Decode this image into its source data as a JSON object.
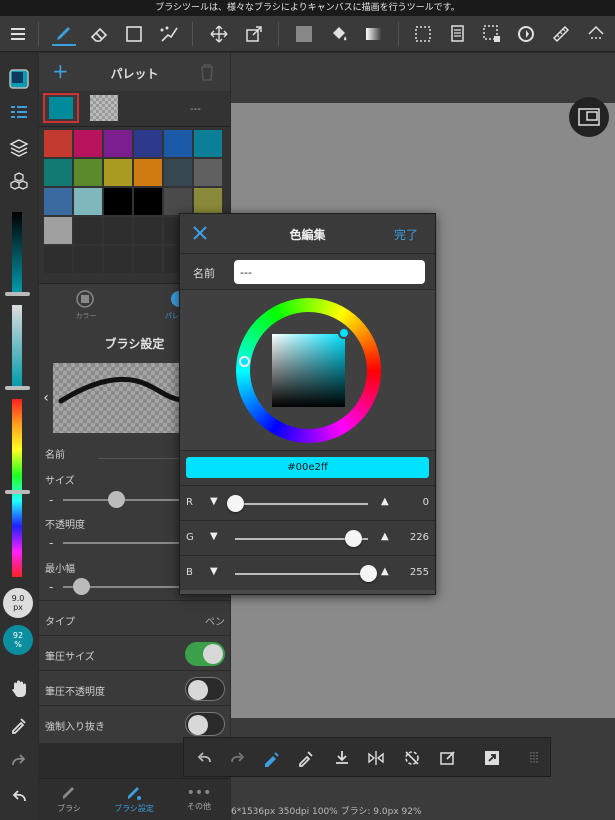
{
  "tipbar": {
    "text": "ブラシツールは、様々なブラシによりキャンバスに描画を行うツールです。"
  },
  "toolbar": {
    "icons": [
      "menu-icon",
      "brush-icon",
      "eraser-icon",
      "rect-icon",
      "dot-brush-icon",
      "move-icon",
      "transform-icon",
      "fill-color-icon",
      "bucket-icon",
      "gradient-icon",
      "select-icon",
      "layer-list-icon",
      "select-rect-icon",
      "rotate-icon",
      "ruler-icon",
      "snap-icon"
    ]
  },
  "palette": {
    "title": "パレット",
    "add_label": "+",
    "current_name": "---",
    "current_color": "#008b9a",
    "colors": [
      [
        "#c33a2f",
        "#b8145e",
        "#7b1f8f",
        "#2d3a8c",
        "#1a5aa6",
        "#0b7f95"
      ],
      [
        "#127a73",
        "#5a8a2c",
        "#a99a22",
        "#d07a12",
        "#37474f",
        "#606060"
      ],
      [
        "#3b6aa0",
        "#7fb8bc",
        "#000000",
        "#000000",
        "#4a4a4a",
        "#8a8a3a"
      ],
      [
        "#a0a0a0",
        "#2e2e2e",
        "#2e2e2e",
        "#2e2e2e",
        "#2e2e2e",
        "#2e2e2e"
      ],
      [
        "#2e2e2e",
        "#2e2e2e",
        "#2e2e2e",
        "#2e2e2e",
        "#2e2e2e",
        "#2e2e2e"
      ]
    ]
  },
  "modetabs": {
    "color": "カラー",
    "palette": "パレ"
  },
  "brush": {
    "title": "ブラシ設定",
    "name_label": "名前",
    "size_label": "サイズ",
    "opacity_label": "不透明度",
    "minwidth_label": "最小幅",
    "minus": "-",
    "type_label": "タイプ",
    "type_value": "ペン",
    "pressure_size": "筆圧サイズ",
    "pressure_opacity": "筆圧不透明度",
    "forced_taper": "強制入り抜き",
    "pressure_size_on": true,
    "pressure_opacity_on": false,
    "forced_taper_on": false,
    "size_slider": 0.35,
    "minwidth_slider": 0.12
  },
  "rail": {
    "size_value": "9.0",
    "size_unit": "px",
    "opacity_value": "92",
    "opacity_unit": "%"
  },
  "bottomtabs": {
    "brush": "ブラシ",
    "brush_settings": "ブラシ設定",
    "other": "その他"
  },
  "status": {
    "text": "6*1536px 350dpi 100% ブラシ: 9.0px 92%"
  },
  "dialog": {
    "title": "色編集",
    "done": "完了",
    "name_label": "名前",
    "name_value": "---",
    "hex": "#00e2ff",
    "r_label": "R",
    "g_label": "G",
    "b_label": "B",
    "down": "▼",
    "up": "▲",
    "r": 0,
    "g": 226,
    "b": 255,
    "r_text": "0",
    "g_text": "226",
    "b_text": "255"
  },
  "colors": {
    "accent": "#3b9fe0",
    "toggle_on": "#3aa04a",
    "selected": "#00e2ff"
  }
}
